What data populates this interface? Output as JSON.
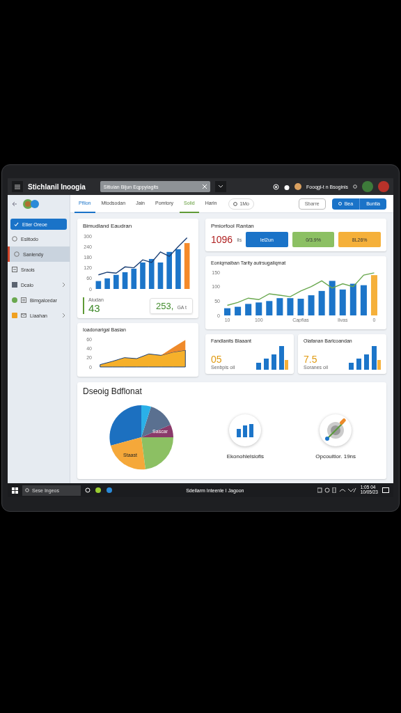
{
  "window": {
    "title": "Stichlanil Inoogia",
    "search_tab": "Sitiuian Bijun Eqppyiagits",
    "user": "Fooqgi-t n Bsoginis"
  },
  "tabs": [
    {
      "label": "Pfilon",
      "selected": true,
      "color": "#1a73c8"
    },
    {
      "label": "Mtodsodan",
      "selected": false
    },
    {
      "label": "Jain",
      "selected": false
    },
    {
      "label": "Pomtory",
      "selected": false
    },
    {
      "label": "Solid",
      "selected": true,
      "color": "#5f9a36"
    },
    {
      "label": "Harin",
      "selected": false
    }
  ],
  "pill": "1Mo",
  "buttons": {
    "outline": "Sbarre",
    "primary": [
      "Bea",
      "Buntia"
    ]
  },
  "sidebar": {
    "items": [
      {
        "label": "Etier Oreoe",
        "kind": "check",
        "selected": true,
        "highlighted": false,
        "chevron": false
      },
      {
        "label": "Eslitodo",
        "kind": "circle",
        "selected": false,
        "highlighted": false,
        "chevron": false
      },
      {
        "label": "Sanlendy",
        "kind": "circle",
        "selected": false,
        "highlighted": true,
        "chevron": false
      },
      {
        "label": "Sraois",
        "kind": "doc",
        "selected": false,
        "highlighted": false,
        "chevron": false
      },
      {
        "label": "Dcalo",
        "kind": "folder",
        "selected": false,
        "highlighted": false,
        "chevron": true
      },
      {
        "label": "Bimgalcedar",
        "kind": "grid",
        "selected": false,
        "highlighted": false,
        "chevron": false,
        "color": "#6aa84f"
      },
      {
        "label": "Liaahan",
        "kind": "mail",
        "selected": false,
        "highlighted": false,
        "chevron": true,
        "color": "#f0a020"
      }
    ]
  },
  "cards": {
    "trend": {
      "title": "Bimudland Eaudran",
      "chart_data": {
        "type": "bar",
        "categories": [
          null,
          null,
          null,
          null,
          null,
          null,
          null,
          null,
          null,
          null,
          null
        ],
        "ylim": [
          0,
          300
        ],
        "yticks": [
          0,
          60,
          120,
          180,
          240,
          300
        ],
        "series": [
          {
            "color": "#1c75c9",
            "values": [
              45,
              60,
              80,
              95,
              115,
              150,
              170,
              150,
              210,
              225,
              null
            ]
          },
          {
            "color": "#f58a2a",
            "values": [
              null,
              null,
              null,
              null,
              null,
              null,
              null,
              null,
              null,
              null,
              260
            ]
          },
          {
            "type": "line",
            "color": "#1b3f74",
            "values": [
              80,
              95,
              90,
              125,
              120,
              165,
              150,
              210,
              185,
              240,
              290
            ]
          }
        ]
      }
    },
    "stat": {
      "label": "Aiudan",
      "value": "43",
      "value_2": "253,",
      "unit": "GA t"
    },
    "area": {
      "title": "Ioadonarigal Basian",
      "chart_data": {
        "type": "area",
        "stacked": true,
        "categories": [
          null,
          null,
          null,
          null,
          null,
          null,
          null,
          null
        ],
        "ylim": [
          0,
          60
        ],
        "yticks": [
          0,
          20,
          40,
          60
        ],
        "series": [
          {
            "color": "#f6b02a",
            "values": [
              5,
              12,
              20,
              18,
              28,
              25,
              32,
              36
            ]
          },
          {
            "color": "#ef8a2a",
            "values": [
              0,
              0,
              0,
              0,
              0,
              0,
              10,
              22
            ]
          }
        ]
      }
    },
    "summary": {
      "title": "Pmiorfool Rantan",
      "value": "1096",
      "unit": "Ils",
      "pills": [
        {
          "label": "lel2un",
          "color": "#1a73c8"
        },
        {
          "label": "0/3.9%",
          "color": "#8cc063"
        },
        {
          "label": "8L26%",
          "color": "#f5b03a"
        }
      ]
    },
    "bars": {
      "title": "Eoniqmaiban Tarity autrsugaliqmat",
      "chart_data": {
        "type": "bar",
        "categories": [
          "10",
          null,
          null,
          "100",
          null,
          null,
          null,
          "Capfias",
          null,
          null,
          null,
          "Ilvas",
          null,
          null,
          "0"
        ],
        "ylim": [
          0,
          150
        ],
        "yticks": [
          0,
          50,
          100,
          150
        ],
        "series": [
          {
            "color": "#1c75c9",
            "values": [
              25,
              30,
              40,
              45,
              50,
              60,
              60,
              58,
              70,
              85,
              120,
              90,
              110,
              105,
              null
            ]
          },
          {
            "color": "#f5b03a",
            "values": [
              null,
              null,
              null,
              null,
              null,
              null,
              null,
              null,
              null,
              null,
              null,
              null,
              null,
              null,
              140
            ]
          },
          {
            "type": "line",
            "color": "#6aa84f",
            "values": [
              35,
              45,
              60,
              55,
              75,
              70,
              65,
              85,
              100,
              120,
              95,
              110,
              100,
              140,
              148
            ]
          }
        ]
      }
    },
    "mini": [
      {
        "title": "Fandlanits Blaaant",
        "value": "05",
        "caption": "Senbpis oil"
      },
      {
        "title": "Oiafanan Barlcoandan",
        "value": "7.5",
        "caption": "Soranes oil"
      }
    ],
    "breakdown": {
      "title": "Dseoig Bdflonat",
      "pie_labels": [
        "Sascar",
        "Staast"
      ],
      "features": [
        {
          "kind": "bars",
          "label": "Ekonohlelsiofis"
        },
        {
          "kind": "target",
          "label": "Opcouitior. 19ns"
        }
      ]
    }
  },
  "taskbar": {
    "search": "Sese Ingeos",
    "title": "Sdeilarm Inteenle I Jagoon",
    "time": "1:05 04",
    "date": "10/05/23"
  }
}
